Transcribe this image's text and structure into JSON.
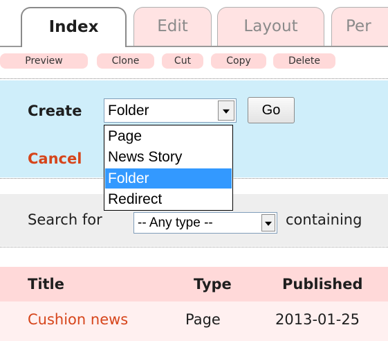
{
  "tabs": [
    {
      "label": "Index",
      "active": true
    },
    {
      "label": "Edit",
      "active": false
    },
    {
      "label": "Layout",
      "active": false
    },
    {
      "label": "Per",
      "active": false
    }
  ],
  "actions": [
    "Preview",
    "Clone",
    "Cut",
    "Copy",
    "Delete"
  ],
  "create": {
    "label": "Create",
    "selected": "Folder",
    "go_label": "Go",
    "cancel_label": "Cancel",
    "options": [
      "Page",
      "News Story",
      "Folder",
      "Redirect"
    ],
    "highlighted_option": "Folder"
  },
  "search": {
    "label": "Search for",
    "type_selected": "-- Any type --",
    "containing_label": "containing"
  },
  "table": {
    "columns": [
      "Title",
      "Type",
      "Published"
    ],
    "rows": [
      {
        "title": "Cushion news",
        "type": "Page",
        "published": "2013-01-25"
      }
    ]
  },
  "colors": {
    "tab_inactive_bg": "#ffe3e3",
    "panel_bg": "#cfeefa",
    "link": "#d6451b",
    "highlight": "#3399ff",
    "header_bg": "#ffd9d9"
  },
  "icons": [
    "chevron-down-icon"
  ]
}
